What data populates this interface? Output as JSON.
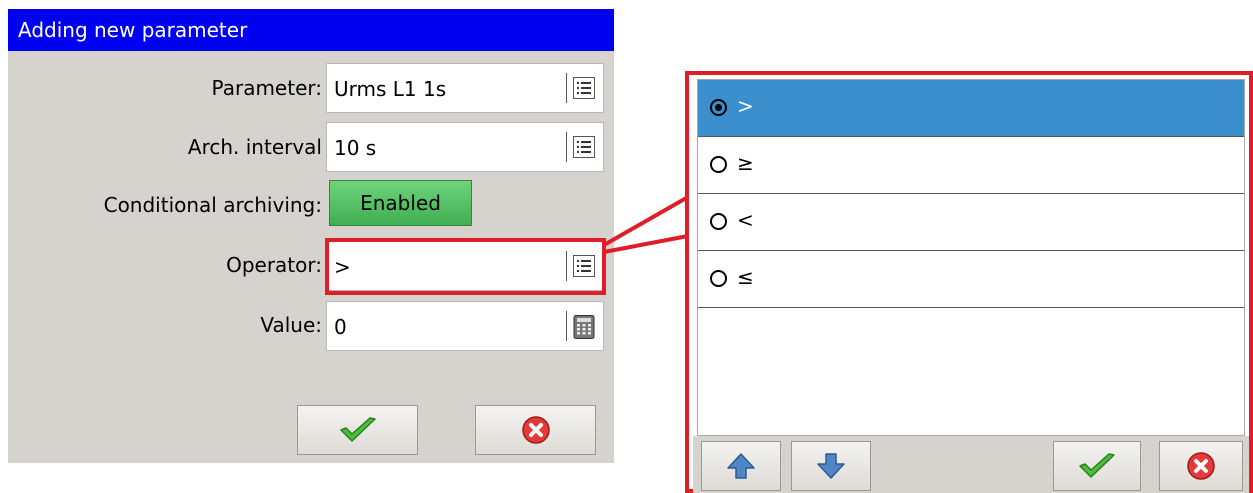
{
  "dialog": {
    "title": "Adding new parameter",
    "fields": [
      {
        "label": "Parameter:",
        "value": "Urms L1 1s",
        "button_icon": "list-icon"
      },
      {
        "label": "Arch. interval",
        "value": "10 s",
        "button_icon": "list-icon"
      },
      {
        "label": "Operator:",
        "value": ">",
        "button_icon": "list-icon"
      },
      {
        "label": "Value:",
        "value": "0",
        "button_icon": "calculator-icon"
      }
    ],
    "conditional": {
      "label": "Conditional archiving:",
      "toggle_label": "Enabled"
    },
    "buttons": {
      "ok_icon": "checkmark-icon",
      "cancel_icon": "cancel-icon"
    }
  },
  "operator_list": {
    "options": [
      {
        "label": ">",
        "selected": true
      },
      {
        "label": "≥",
        "selected": false
      },
      {
        "label": "<",
        "selected": false
      },
      {
        "label": "≤",
        "selected": false
      }
    ],
    "toolbar": [
      "arrow-up-icon",
      "arrow-down-icon",
      "checkmark-icon",
      "cancel-icon"
    ]
  },
  "colors": {
    "titlebar": "#0000f0",
    "selected_row": "#3a8fcc",
    "toggle_enabled": "#4cbd5e",
    "highlight": "#e01e2a",
    "dialog_bg": "#d6d3ce"
  }
}
